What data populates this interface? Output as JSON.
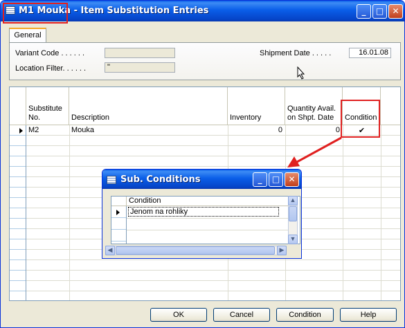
{
  "window": {
    "title": "M1 Mouka - Item Substitution Entries",
    "minimize_glyph": "_",
    "maximize_glyph": "□",
    "close_glyph": "✕"
  },
  "tabs": [
    {
      "label": "General"
    }
  ],
  "general": {
    "variant_code_label": "Variant Code . . . . . .",
    "variant_code_value": "",
    "location_filter_label": "Location Filter. . . . . .",
    "location_filter_value": "\"",
    "shipment_date_label": "Shipment Date . . . . .",
    "shipment_date_value": "16.01.08"
  },
  "grid": {
    "columns": [
      {
        "key": "substitute_no",
        "label": "Substitute No."
      },
      {
        "key": "description",
        "label": "Description"
      },
      {
        "key": "inventory",
        "label": "Inventory"
      },
      {
        "key": "qty_avail",
        "label": "Quantity Avail. on Shpt. Date"
      },
      {
        "key": "condition",
        "label": "Condition"
      }
    ],
    "rows": [
      {
        "substitute_no": "M2",
        "description": "Mouka",
        "inventory": "0",
        "qty_avail": "0",
        "condition": "✔"
      }
    ]
  },
  "buttons": {
    "ok": "OK",
    "cancel": "Cancel",
    "condition": "Condition",
    "help": "Help"
  },
  "sub_dialog": {
    "title": "Sub. Conditions",
    "column": "Condition",
    "rows": [
      {
        "condition": "Jenom na rohliky"
      }
    ]
  },
  "colors": {
    "annotation_red": "#e02020",
    "title_blue": "#0a5ee8"
  }
}
